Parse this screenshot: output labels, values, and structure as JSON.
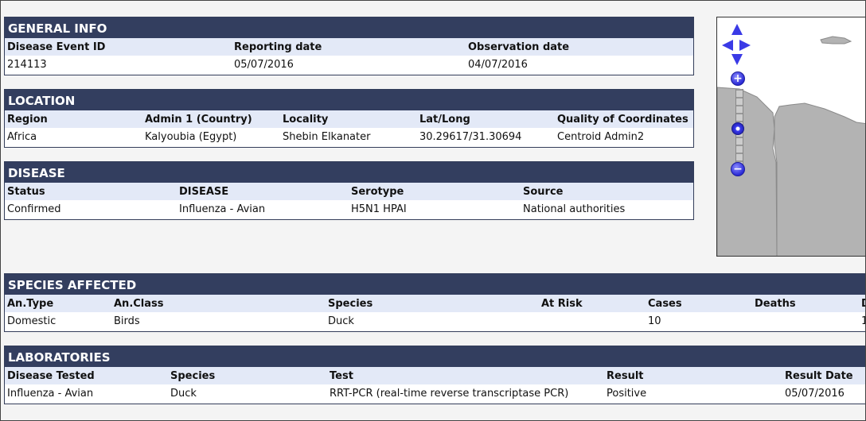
{
  "general_info": {
    "title": "GENERAL INFO",
    "headers": [
      "Disease Event ID",
      "Reporting date",
      "Observation date"
    ],
    "values": [
      "214113",
      "05/07/2016",
      "04/07/2016"
    ]
  },
  "location": {
    "title": "LOCATION",
    "headers": [
      "Region",
      "Admin 1 (Country)",
      "Locality",
      "Lat/Long",
      "Quality of Coordinates"
    ],
    "values": [
      "Africa",
      "Kalyoubia (Egypt)",
      "Shebin Elkanater",
      "30.29617/31.30694",
      "Centroid Admin2"
    ]
  },
  "disease": {
    "title": "DISEASE",
    "headers": [
      "Status",
      "DISEASE",
      "Serotype",
      "Source"
    ],
    "values": [
      "Confirmed",
      "Influenza - Avian",
      "H5N1 HPAI",
      "National authorities"
    ]
  },
  "species_affected": {
    "title": "SPECIES AFFECTED",
    "headers": [
      "An.Type",
      "An.Class",
      "Species",
      "At Risk",
      "Cases",
      "Deaths",
      "D"
    ],
    "values": [
      "Domestic",
      "Birds",
      "Duck",
      "",
      "10",
      "",
      "1"
    ]
  },
  "laboratories": {
    "title": "LABORATORIES",
    "headers": [
      "Disease Tested",
      "Species",
      "Test",
      "Result",
      "Result Date"
    ],
    "values": [
      "Influenza - Avian",
      "Duck",
      "RRT-PCR (real-time reverse transcriptase PCR)",
      "Positive",
      "05/07/2016"
    ]
  },
  "map": {
    "zoom_in_symbol": "+",
    "zoom_out_symbol": "−",
    "land_color": "#b3b3b3",
    "control_color": "#3a3ae6"
  }
}
